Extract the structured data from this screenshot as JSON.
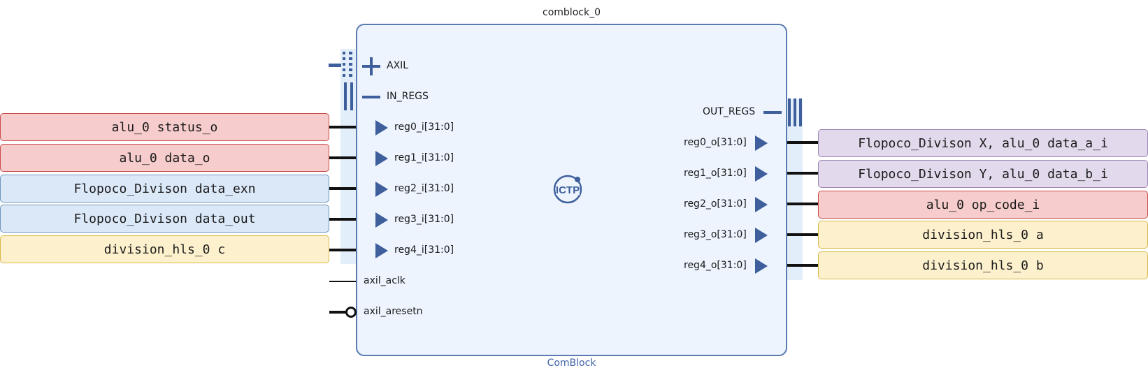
{
  "block": {
    "instance_name": "comblock_0",
    "ip_name": "ComBlock",
    "logo_text": "ICTP"
  },
  "interfaces": {
    "axil": "AXIL",
    "in_regs": "IN_REGS",
    "out_regs": "OUT_REGS"
  },
  "inputs": [
    "reg0_i[31:0]",
    "reg1_i[31:0]",
    "reg2_i[31:0]",
    "reg3_i[31:0]",
    "reg4_i[31:0]"
  ],
  "outputs": [
    "reg0_o[31:0]",
    "reg1_o[31:0]",
    "reg2_o[31:0]",
    "reg3_o[31:0]",
    "reg4_o[31:0]"
  ],
  "clock": "axil_aclk",
  "reset": "axil_aresetn",
  "left_labels": [
    {
      "text": "alu_0 status_o",
      "color": "red"
    },
    {
      "text": "alu_0 data_o",
      "color": "red"
    },
    {
      "text": "Flopoco_Divison data_exn",
      "color": "blue"
    },
    {
      "text": "Flopoco_Divison data_out",
      "color": "blue"
    },
    {
      "text": "division_hls_0 c",
      "color": "yellow"
    }
  ],
  "right_labels": [
    {
      "text": "Flopoco_Divison X, alu_0 data_a_i",
      "color": "purple"
    },
    {
      "text": "Flopoco_Divison Y, alu_0 data_b_i",
      "color": "purple"
    },
    {
      "text": "alu_0 op_code_i",
      "color": "red"
    },
    {
      "text": "division_hls_0 a",
      "color": "yellow"
    },
    {
      "text": "division_hls_0 b",
      "color": "yellow"
    }
  ],
  "colors": {
    "block_border": "#5a7bb0",
    "block_fill": "#edf4fe",
    "port_blue": "#3e5f9c",
    "ip_name": "#3f62a6"
  }
}
